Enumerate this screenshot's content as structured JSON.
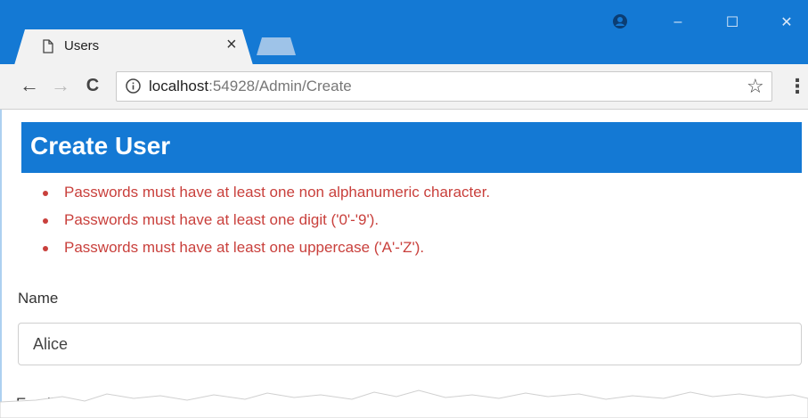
{
  "browser": {
    "tab_title": "Users",
    "tab_close": "×",
    "address": {
      "host": "localhost",
      "rest": ":54928/Admin/Create"
    },
    "window_controls": {
      "minimize": "–",
      "maximize": "☐",
      "close": "✕"
    },
    "nav": {
      "back": "←",
      "forward": "→",
      "reload": "C"
    },
    "star": "☆",
    "menu": "⋮",
    "accent_color": "#1479d4"
  },
  "page": {
    "heading": "Create User",
    "errors": [
      "Passwords must have at least one non alphanumeric character.",
      "Passwords must have at least one digit ('0'-'9').",
      "Passwords must have at least one uppercase ('A'-'Z')."
    ],
    "error_color": "#c9403c",
    "name_label": "Name",
    "name_value": "Alice",
    "email_label": "Email"
  }
}
